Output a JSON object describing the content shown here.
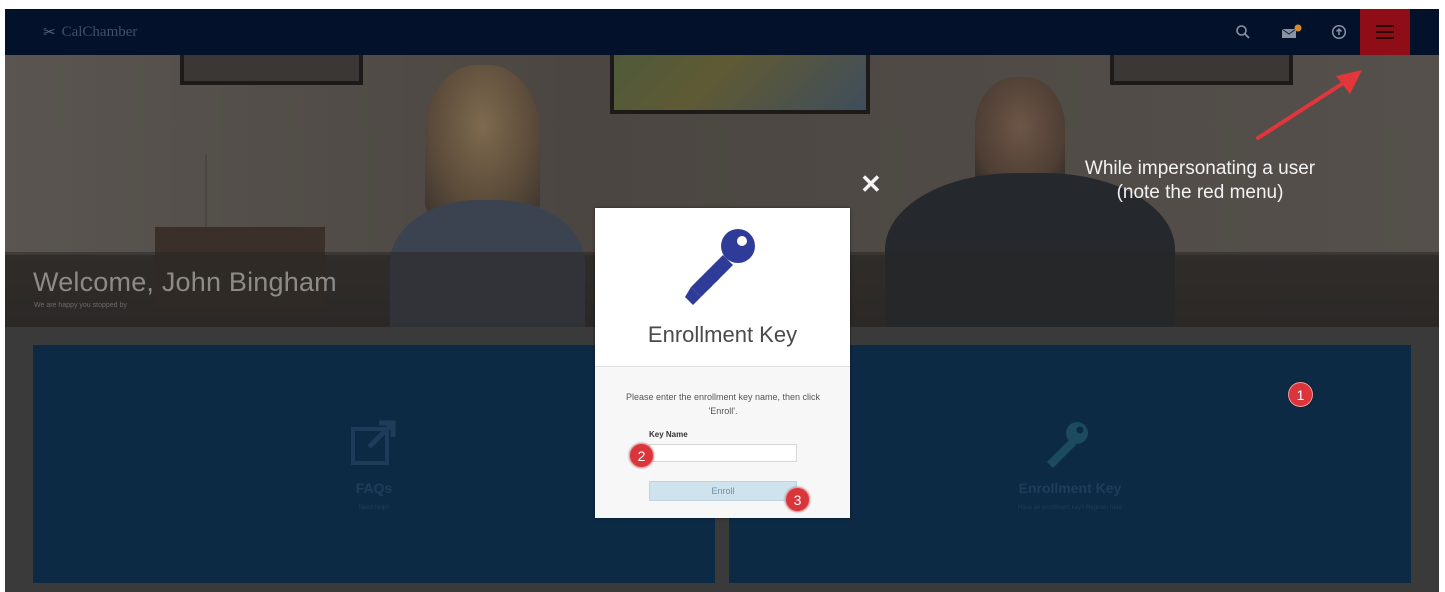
{
  "header": {
    "logo_text": "CalChamber",
    "icons": [
      "search-icon",
      "mail-icon",
      "upload-icon",
      "hamburger-menu-icon"
    ],
    "menu_color": "#8e0d17"
  },
  "hero": {
    "welcome": "Welcome, John Bingham",
    "subtitle": "We are happy you stopped by"
  },
  "tiles": [
    {
      "title": "FAQs",
      "subtitle": "Need help?",
      "icon": "external-link-icon"
    },
    {
      "title": "Enrollment Key",
      "subtitle": "Have an enrollment key? Register here",
      "icon": "key-icon"
    }
  ],
  "annotation": {
    "line1": "While impersonating a user",
    "line2": "(note the red menu)",
    "badges": [
      "1",
      "2",
      "3"
    ]
  },
  "modal": {
    "title": "Enrollment Key",
    "message": "Please enter the enrollment key name, then click 'Enroll'.",
    "field_label": "Key Name",
    "field_value": "",
    "button": "Enroll",
    "icon": "key-icon",
    "icon_color": "#2f3b98"
  },
  "colors": {
    "nav_bg": "#04112a",
    "tile_bg": "#0d2a44",
    "badge": "#d9353a",
    "arrow": "#e2363b"
  }
}
